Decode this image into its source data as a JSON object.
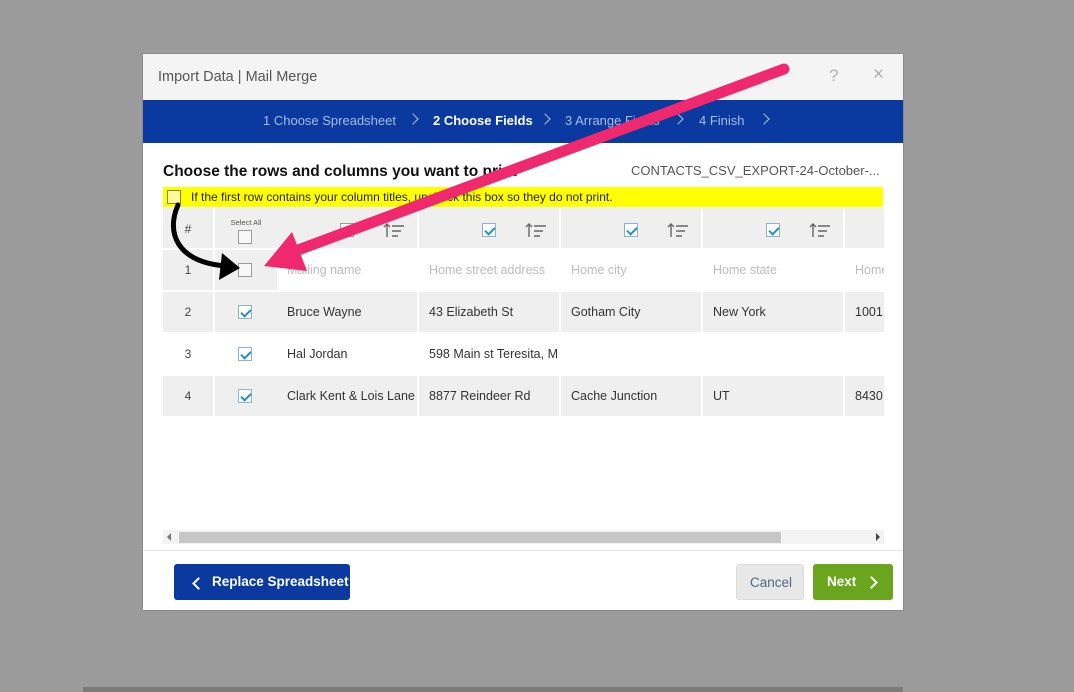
{
  "dialog": {
    "title": "Import Data | Mail Merge",
    "help_icon": "?",
    "close_icon": "×"
  },
  "steps": [
    {
      "label": "1 Choose Spreadsheet",
      "active": false
    },
    {
      "label": "2 Choose Fields",
      "active": true
    },
    {
      "label": "3 Arrange Fields",
      "active": false
    },
    {
      "label": "4 Finish",
      "active": false
    }
  ],
  "heading": "Choose the rows and columns you want to print",
  "filename": "CONTACTS_CSV_EXPORT-24-October-...",
  "notice": {
    "checked": false,
    "text": "If the first row contains your column titles, uncheck this box so they do not print."
  },
  "grid": {
    "header_num": "#",
    "select_all_label": "Select All",
    "column_checkboxes": [
      false,
      true,
      true,
      true,
      true
    ],
    "rows": [
      {
        "num": "1",
        "checked": false,
        "cells": [
          "Mailing name",
          "Home street address",
          "Home city",
          "Home state",
          "Home"
        ]
      },
      {
        "num": "2",
        "checked": true,
        "cells": [
          "Bruce Wayne",
          "43 Elizabeth St",
          "Gotham City",
          "New York",
          "1001"
        ]
      },
      {
        "num": "3",
        "checked": true,
        "cells": [
          "Hal Jordan",
          "598 Main st Teresita, M",
          "",
          "",
          ""
        ]
      },
      {
        "num": "4",
        "checked": true,
        "cells": [
          "Clark Kent & Lois Lane",
          "8877 Reindeer Rd",
          "Cache Junction",
          "UT",
          "8430"
        ]
      }
    ]
  },
  "buttons": {
    "replace": "Replace Spreadsheet",
    "cancel": "Cancel",
    "next": "Next"
  },
  "colors": {
    "step_bar": "#0a3a9f",
    "notice_bg": "#ffff00",
    "next_button": "#6aa51e",
    "annotation_arrow": "#f0286e"
  }
}
